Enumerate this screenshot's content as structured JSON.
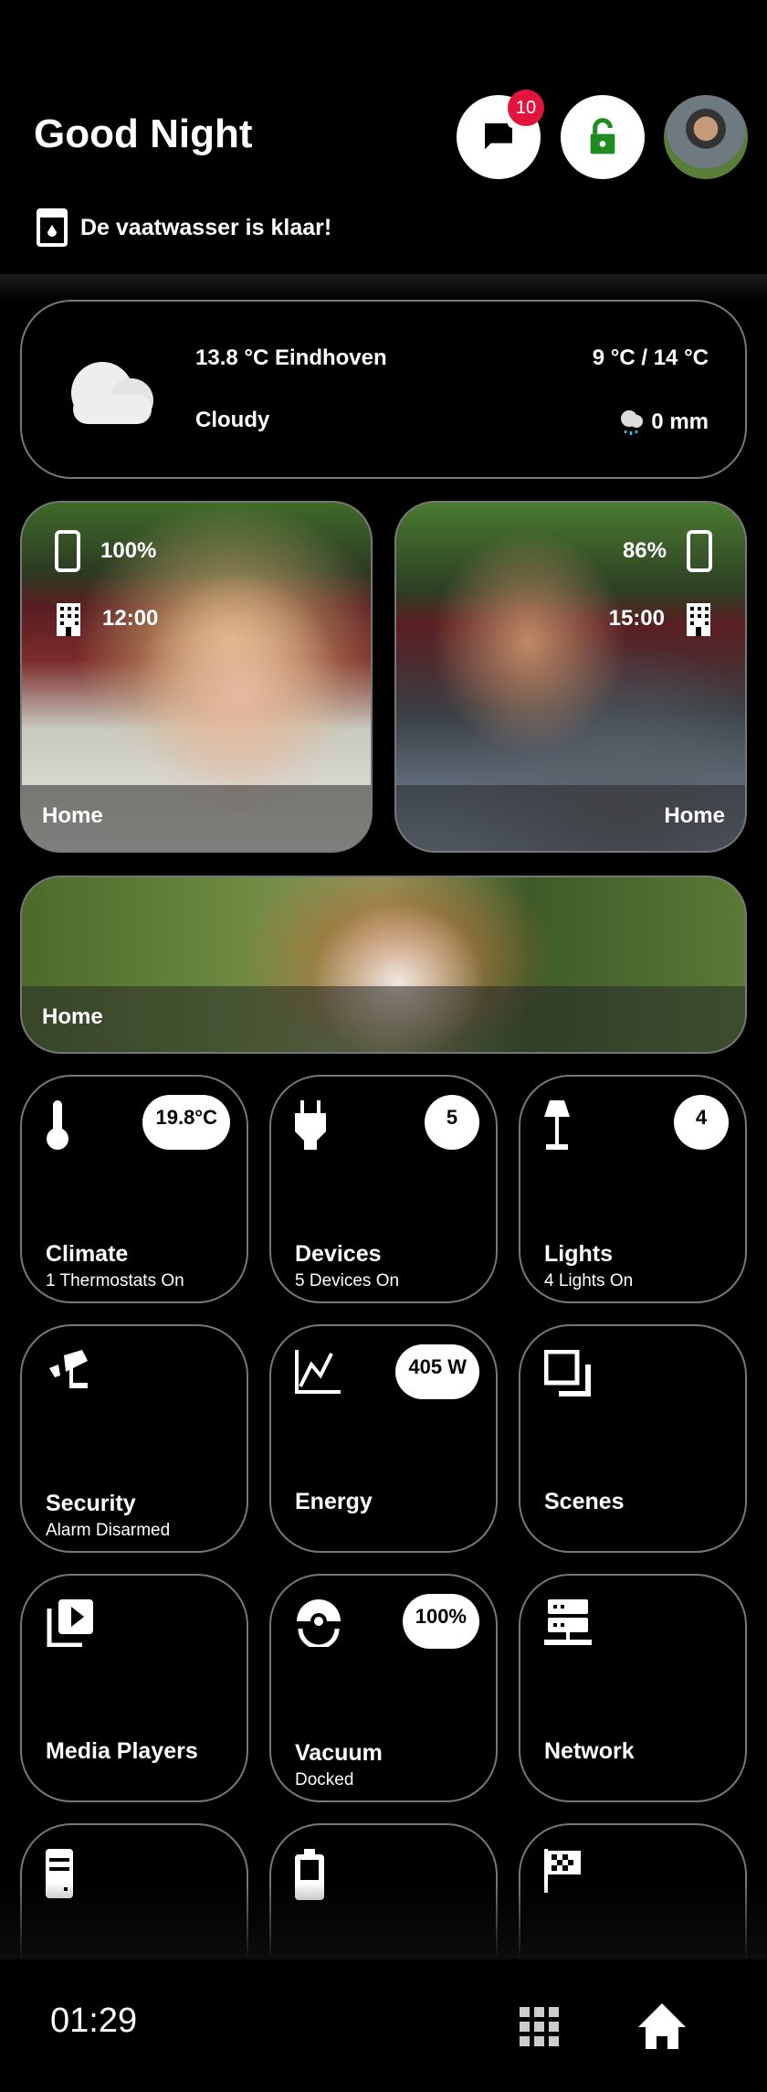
{
  "header": {
    "greeting": "Good Night",
    "notification_count": "10",
    "lock_color": "#1e8c1e",
    "badge_color": "#e0143c"
  },
  "notification": {
    "icon": "dishwasher-icon",
    "text": "De vaatwasser is klaar!"
  },
  "weather": {
    "icon": "cloud-icon",
    "current": "13.8 °C Eindhoven",
    "condition": "Cloudy",
    "range": "9 °C / 14 °C",
    "precipitation": "0 mm"
  },
  "persons": [
    {
      "battery": "100%",
      "time": "12:00",
      "location": "Home"
    },
    {
      "battery": "86%",
      "time": "15:00",
      "location": "Home"
    }
  ],
  "pet": {
    "location": "Home"
  },
  "tiles": [
    {
      "name": "Climate",
      "status": "1 Thermostats On",
      "badge": "19.8°C",
      "icon": "thermometer-icon"
    },
    {
      "name": "Devices",
      "status": "5 Devices On",
      "badge": "5",
      "icon": "plug-icon"
    },
    {
      "name": "Lights",
      "status": "4 Lights On",
      "badge": "4",
      "icon": "floor-lamp-icon"
    },
    {
      "name": "Security",
      "status": "Alarm Disarmed",
      "badge": "",
      "icon": "cctv-icon"
    },
    {
      "name": "Energy",
      "status": "",
      "badge": "405 W",
      "icon": "chart-line-icon"
    },
    {
      "name": "Scenes",
      "status": "",
      "badge": "",
      "icon": "scenes-icon"
    },
    {
      "name": "Media Players",
      "status": "",
      "badge": "",
      "icon": "play-box-multiple-icon"
    },
    {
      "name": "Vacuum",
      "status": "Docked",
      "badge": "100%",
      "icon": "robot-vacuum-icon"
    },
    {
      "name": "Network",
      "status": "",
      "badge": "",
      "icon": "server-network-icon"
    },
    {
      "name": "",
      "status": "",
      "badge": "",
      "icon": "desktop-tower-icon"
    },
    {
      "name": "",
      "status": "",
      "badge": "",
      "icon": "battery-icon"
    },
    {
      "name": "",
      "status": "",
      "badge": "",
      "icon": "flag-checkered-icon"
    }
  ],
  "footer": {
    "time": "01:29"
  }
}
